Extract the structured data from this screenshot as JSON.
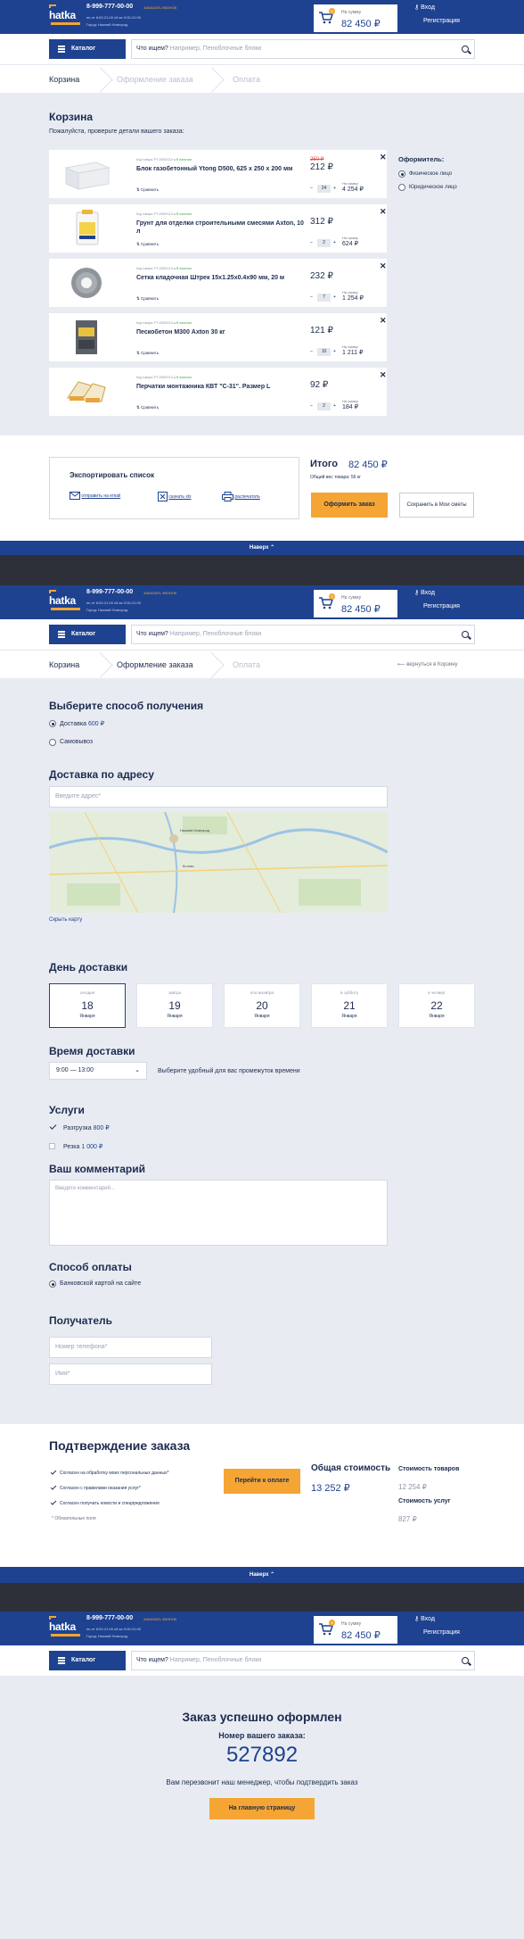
{
  "header": {
    "logo_text": "hatka",
    "phone": "8-999-777-00-00",
    "callback": "ЗАКАЗАТЬ ЗВОНОК",
    "hours": "пн-пт 8:00-21:00  сб-вс 9:00-21:00",
    "city": "Город: Нижний Новгород",
    "cart_label": "На сумму",
    "cart_total": "82 450 ₽",
    "cart_count": "5",
    "login": "Вход",
    "register": "Регистрация"
  },
  "search": {
    "catalog": "Каталог",
    "prefix": "Что ищем?",
    "placeholder": "Например, Пеноблочные блоки"
  },
  "footer_label": "Наверх",
  "screen1": {
    "steps": [
      "Корзина",
      "Оформление заказа",
      "Оплата"
    ],
    "title": "Корзина",
    "subtitle": "Пожалуйста, проверьте детали вашего заказа:",
    "items": [
      {
        "code": "Код товара: РТ-00000113",
        "stock": "В наличии",
        "name": "Блок газобетонный Ytong D500, 625 x 250 x 200 мм",
        "old_price": "250 ₽",
        "price": "212 ₽",
        "sum_label": "На сумму",
        "qty": "24",
        "sum": "4 254 ₽",
        "compare": "Сравнить"
      },
      {
        "code": "Код товара: РТ-00000113",
        "stock": "В наличии",
        "name": "Грунт для отделки строительными смесями Axton, 10 л",
        "old_price": "",
        "price": "312 ₽",
        "sum_label": "На сумму",
        "qty": "2",
        "sum": "624 ₽",
        "compare": "Сравнить"
      },
      {
        "code": "Код товара: РТ-00000113",
        "stock": "В наличии",
        "name": "Сетка кладочная Штрек 15x1.25x0.4x90 мм, 20 м",
        "old_price": "",
        "price": "232 ₽",
        "sum_label": "На сумму",
        "qty": "7",
        "sum": "1 254 ₽",
        "compare": "Сравнить"
      },
      {
        "code": "Код товара: РТ-00000113",
        "stock": "В наличии",
        "name": "Пескобетон М300 Axton 30 кг",
        "old_price": "",
        "price": "121 ₽",
        "sum_label": "На сумму",
        "qty": "10",
        "sum": "1 211 ₽",
        "compare": "Сравнить"
      },
      {
        "code": "Код товара: РТ-00000113",
        "stock": "В наличии",
        "name": "Перчатки монтажника КВТ \"С-31\". Размер L",
        "old_price": "",
        "price": "92 ₽",
        "sum_label": "На сумму",
        "qty": "2",
        "sum": "184 ₽",
        "compare": "Сравнить"
      }
    ],
    "buyer_title": "Оформитель:",
    "buyer_options": [
      "Физическое лицо",
      "Юридическое лицо"
    ],
    "export_title": "Экспортировать список",
    "export_email": "отправить на email",
    "export_xls": "скачать xls",
    "export_print": "распечатать",
    "total_label": "Итого",
    "total_value": "82 450 ₽",
    "weight": "Общий вес товара: 56 кг",
    "checkout_btn": "Оформить заказ",
    "save_btn": "Сохранить в Мои сметы"
  },
  "screen2": {
    "steps": [
      "Корзина",
      "Оформление заказа",
      "Оплата"
    ],
    "back_link": "вернуться в Корзину",
    "receive_title": "Выберите способ получения",
    "delivery_label": "Доставка",
    "delivery_price": "600 ₽",
    "pickup_label": "Самовывоз",
    "address_title": "Доставка по адресу",
    "address_placeholder": "Введите адрес*",
    "map_city": "Нижний Новгород",
    "map_city2": "Кстово",
    "hide_map": "Скрыть карту",
    "day_title": "День доставки",
    "days": [
      {
        "weekday": "сегодня",
        "day": "18",
        "month": "Января"
      },
      {
        "weekday": "завтра",
        "day": "19",
        "month": "Января"
      },
      {
        "weekday": "послезавтра",
        "day": "20",
        "month": "Января"
      },
      {
        "weekday": "в субботу",
        "day": "21",
        "month": "Января"
      },
      {
        "weekday": "в четверг",
        "day": "22",
        "month": "Января"
      }
    ],
    "time_title": "Время доставки",
    "time_value": "9:00 — 13:00",
    "time_hint": "Выберите удобный для вас промежуток времени",
    "services_title": "Услуги",
    "unload_label": "Разгрузка",
    "unload_price": "800 ₽",
    "cut_label": "Резка",
    "cut_price": "1 000 ₽",
    "comment_title": "Ваш комментарий",
    "comment_placeholder": "Введите комментарий...",
    "payment_title": "Способ оплаты",
    "payment_value": "Банковской картой на сайте",
    "recipient_title": "Получатель",
    "phone_placeholder": "Номер телефона*",
    "name_placeholder": "Имя*",
    "confirm_title": "Подтверждение заказа",
    "agreements": [
      "Согласен на обработку моих персональных данных*",
      "Согласен с правилами оказания услуг*",
      "Согласен получать новости и спецпредложения"
    ],
    "required_note": "* Обязательные поля",
    "pay_btn": "Перейти к оплате",
    "total_label": "Общая стоимость",
    "total_value": "13 252 ₽",
    "goods_label": "Стоимость товаров",
    "goods_value": "12 254 ₽",
    "services_cost_label": "Стоимость услуг",
    "services_cost_value": "827 ₽"
  },
  "screen3": {
    "title": "Заказ успешно оформлен",
    "number_label": "Номер вашего заказа:",
    "number": "527892",
    "note": "Вам перезвонит наш менеджер, чтобы подтвердить заказ",
    "home_btn": "На главную страницу"
  }
}
